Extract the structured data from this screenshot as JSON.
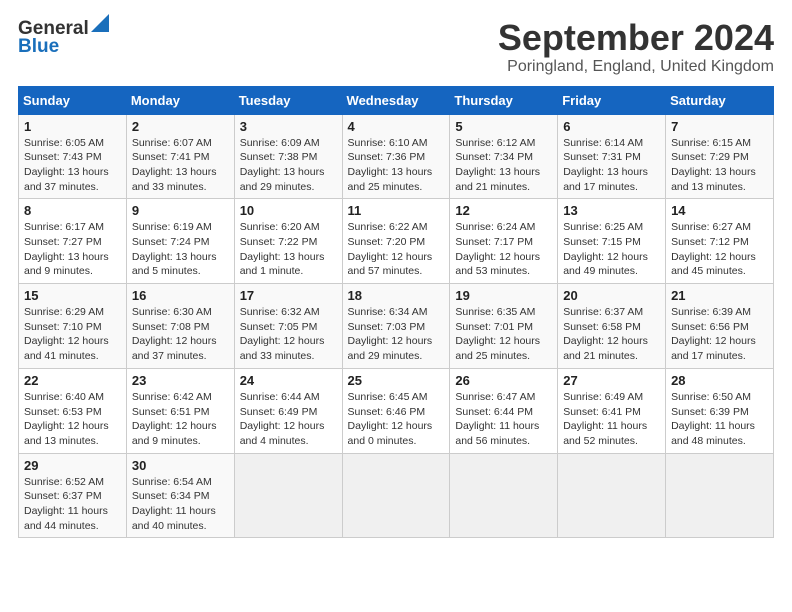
{
  "header": {
    "logo_line1": "General",
    "logo_line2": "Blue",
    "month": "September 2024",
    "location": "Poringland, England, United Kingdom"
  },
  "weekdays": [
    "Sunday",
    "Monday",
    "Tuesday",
    "Wednesday",
    "Thursday",
    "Friday",
    "Saturday"
  ],
  "weeks": [
    [
      {
        "day": "1",
        "info": "Sunrise: 6:05 AM\nSunset: 7:43 PM\nDaylight: 13 hours\nand 37 minutes."
      },
      {
        "day": "2",
        "info": "Sunrise: 6:07 AM\nSunset: 7:41 PM\nDaylight: 13 hours\nand 33 minutes."
      },
      {
        "day": "3",
        "info": "Sunrise: 6:09 AM\nSunset: 7:38 PM\nDaylight: 13 hours\nand 29 minutes."
      },
      {
        "day": "4",
        "info": "Sunrise: 6:10 AM\nSunset: 7:36 PM\nDaylight: 13 hours\nand 25 minutes."
      },
      {
        "day": "5",
        "info": "Sunrise: 6:12 AM\nSunset: 7:34 PM\nDaylight: 13 hours\nand 21 minutes."
      },
      {
        "day": "6",
        "info": "Sunrise: 6:14 AM\nSunset: 7:31 PM\nDaylight: 13 hours\nand 17 minutes."
      },
      {
        "day": "7",
        "info": "Sunrise: 6:15 AM\nSunset: 7:29 PM\nDaylight: 13 hours\nand 13 minutes."
      }
    ],
    [
      {
        "day": "8",
        "info": "Sunrise: 6:17 AM\nSunset: 7:27 PM\nDaylight: 13 hours\nand 9 minutes."
      },
      {
        "day": "9",
        "info": "Sunrise: 6:19 AM\nSunset: 7:24 PM\nDaylight: 13 hours\nand 5 minutes."
      },
      {
        "day": "10",
        "info": "Sunrise: 6:20 AM\nSunset: 7:22 PM\nDaylight: 13 hours\nand 1 minute."
      },
      {
        "day": "11",
        "info": "Sunrise: 6:22 AM\nSunset: 7:20 PM\nDaylight: 12 hours\nand 57 minutes."
      },
      {
        "day": "12",
        "info": "Sunrise: 6:24 AM\nSunset: 7:17 PM\nDaylight: 12 hours\nand 53 minutes."
      },
      {
        "day": "13",
        "info": "Sunrise: 6:25 AM\nSunset: 7:15 PM\nDaylight: 12 hours\nand 49 minutes."
      },
      {
        "day": "14",
        "info": "Sunrise: 6:27 AM\nSunset: 7:12 PM\nDaylight: 12 hours\nand 45 minutes."
      }
    ],
    [
      {
        "day": "15",
        "info": "Sunrise: 6:29 AM\nSunset: 7:10 PM\nDaylight: 12 hours\nand 41 minutes."
      },
      {
        "day": "16",
        "info": "Sunrise: 6:30 AM\nSunset: 7:08 PM\nDaylight: 12 hours\nand 37 minutes."
      },
      {
        "day": "17",
        "info": "Sunrise: 6:32 AM\nSunset: 7:05 PM\nDaylight: 12 hours\nand 33 minutes."
      },
      {
        "day": "18",
        "info": "Sunrise: 6:34 AM\nSunset: 7:03 PM\nDaylight: 12 hours\nand 29 minutes."
      },
      {
        "day": "19",
        "info": "Sunrise: 6:35 AM\nSunset: 7:01 PM\nDaylight: 12 hours\nand 25 minutes."
      },
      {
        "day": "20",
        "info": "Sunrise: 6:37 AM\nSunset: 6:58 PM\nDaylight: 12 hours\nand 21 minutes."
      },
      {
        "day": "21",
        "info": "Sunrise: 6:39 AM\nSunset: 6:56 PM\nDaylight: 12 hours\nand 17 minutes."
      }
    ],
    [
      {
        "day": "22",
        "info": "Sunrise: 6:40 AM\nSunset: 6:53 PM\nDaylight: 12 hours\nand 13 minutes."
      },
      {
        "day": "23",
        "info": "Sunrise: 6:42 AM\nSunset: 6:51 PM\nDaylight: 12 hours\nand 9 minutes."
      },
      {
        "day": "24",
        "info": "Sunrise: 6:44 AM\nSunset: 6:49 PM\nDaylight: 12 hours\nand 4 minutes."
      },
      {
        "day": "25",
        "info": "Sunrise: 6:45 AM\nSunset: 6:46 PM\nDaylight: 12 hours\nand 0 minutes."
      },
      {
        "day": "26",
        "info": "Sunrise: 6:47 AM\nSunset: 6:44 PM\nDaylight: 11 hours\nand 56 minutes."
      },
      {
        "day": "27",
        "info": "Sunrise: 6:49 AM\nSunset: 6:41 PM\nDaylight: 11 hours\nand 52 minutes."
      },
      {
        "day": "28",
        "info": "Sunrise: 6:50 AM\nSunset: 6:39 PM\nDaylight: 11 hours\nand 48 minutes."
      }
    ],
    [
      {
        "day": "29",
        "info": "Sunrise: 6:52 AM\nSunset: 6:37 PM\nDaylight: 11 hours\nand 44 minutes."
      },
      {
        "day": "30",
        "info": "Sunrise: 6:54 AM\nSunset: 6:34 PM\nDaylight: 11 hours\nand 40 minutes."
      },
      {
        "day": "",
        "info": ""
      },
      {
        "day": "",
        "info": ""
      },
      {
        "day": "",
        "info": ""
      },
      {
        "day": "",
        "info": ""
      },
      {
        "day": "",
        "info": ""
      }
    ]
  ]
}
